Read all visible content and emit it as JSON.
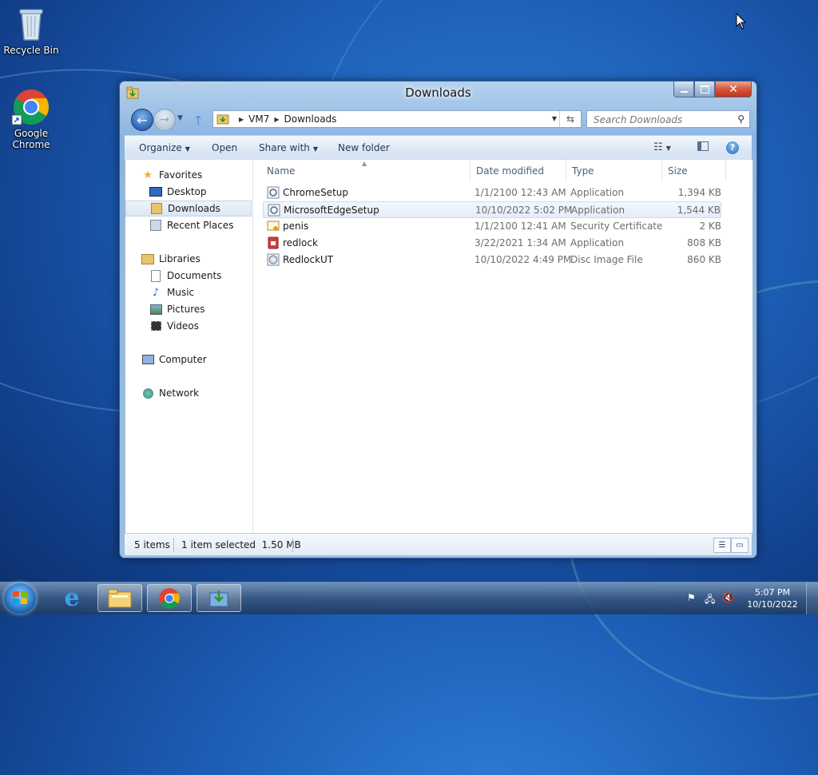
{
  "desktop": {
    "icons": [
      {
        "label": "Recycle Bin"
      },
      {
        "label": "Google Chrome"
      }
    ]
  },
  "window": {
    "title": "Downloads",
    "address": {
      "crumbs": [
        "VM7",
        "Downloads"
      ]
    },
    "search": {
      "placeholder": "Search Downloads"
    },
    "toolbar": {
      "organize": "Organize",
      "open": "Open",
      "share_with": "Share with",
      "new_folder": "New folder"
    },
    "nav": {
      "favorites": "Favorites",
      "desktop": "Desktop",
      "downloads": "Downloads",
      "recent_places": "Recent Places",
      "libraries": "Libraries",
      "documents": "Documents",
      "music": "Music",
      "pictures": "Pictures",
      "videos": "Videos",
      "computer": "Computer",
      "network": "Network"
    },
    "columns": {
      "name": "Name",
      "date": "Date modified",
      "type": "Type",
      "size": "Size"
    },
    "files": [
      {
        "name": "ChromeSetup",
        "date": "1/1/2100 12:43 AM",
        "type": "Application",
        "size": "1,394 KB"
      },
      {
        "name": "MicrosoftEdgeSetup",
        "date": "10/10/2022 5:02 PM",
        "type": "Application",
        "size": "1,544 KB"
      },
      {
        "name": "penis",
        "date": "1/1/2100 12:41 AM",
        "type": "Security Certificate",
        "size": "2 KB"
      },
      {
        "name": "redlock",
        "date": "3/22/2021 1:34 AM",
        "type": "Application",
        "size": "808 KB"
      },
      {
        "name": "RedlockUT",
        "date": "10/10/2022 4:49 PM",
        "type": "Disc Image File",
        "size": "860 KB"
      }
    ],
    "status": {
      "count": "5 items",
      "selection": "1 item selected  1.50 MB"
    }
  },
  "taskbar": {
    "clock": {
      "time": "5:07 PM",
      "date": "10/10/2022"
    }
  },
  "colors": {
    "accent": "#1e395b",
    "selection": "#dce7f5"
  }
}
